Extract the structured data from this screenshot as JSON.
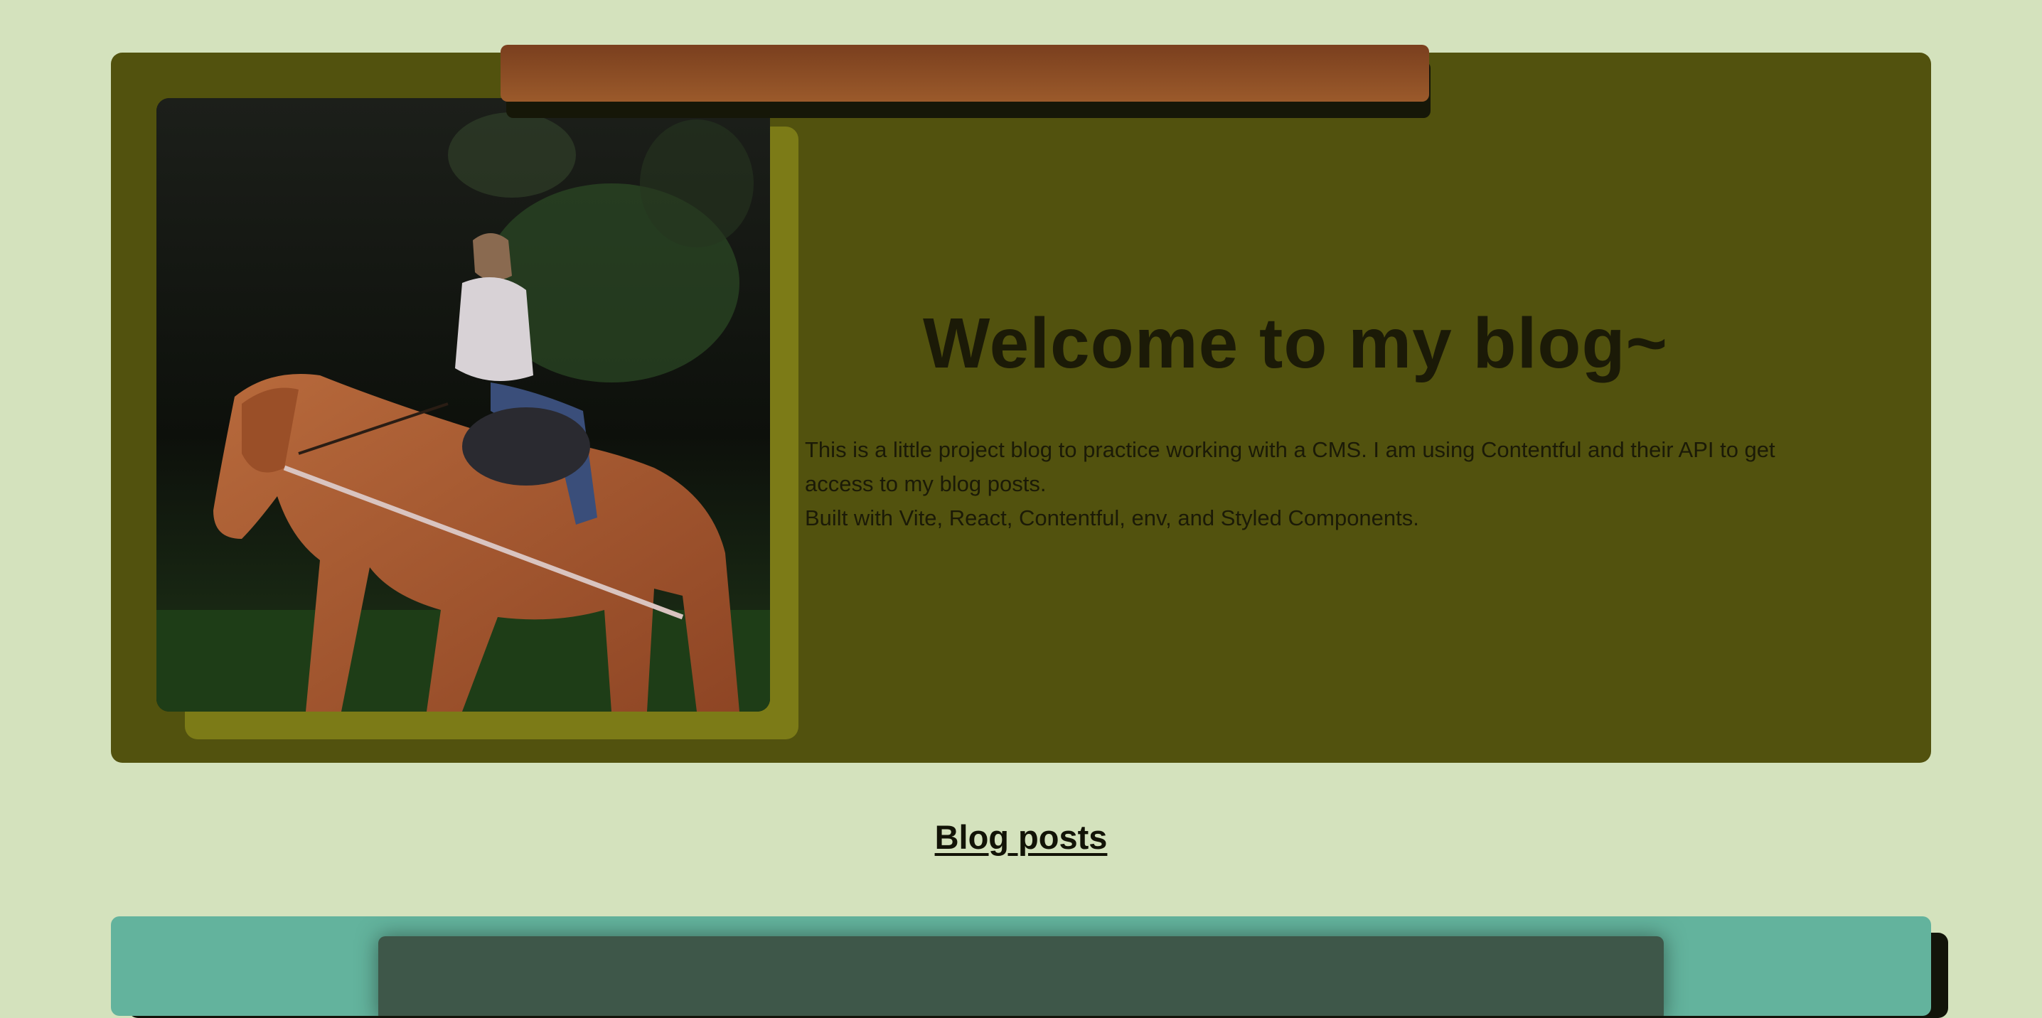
{
  "hero": {
    "title": "Welcome to my blog~",
    "description_line1": "This is a little project blog to practice working with a CMS. I am using Contentful and their API to get access to my blog posts.",
    "description_line2": "Built with Vite, React, Contentful, env, and Styled Components.",
    "image_subject": "girl riding a chestnut horse in a forest clearing"
  },
  "posts_section": {
    "heading": "Blog posts"
  },
  "colors": {
    "page_background": "#d4e2bd",
    "hero_background": "#52520e",
    "photo_shadow": "#7c7b17",
    "text_dark": "#1b1a07",
    "post_card_background": "#63b39d",
    "post_inner_background": "#3e5749"
  }
}
